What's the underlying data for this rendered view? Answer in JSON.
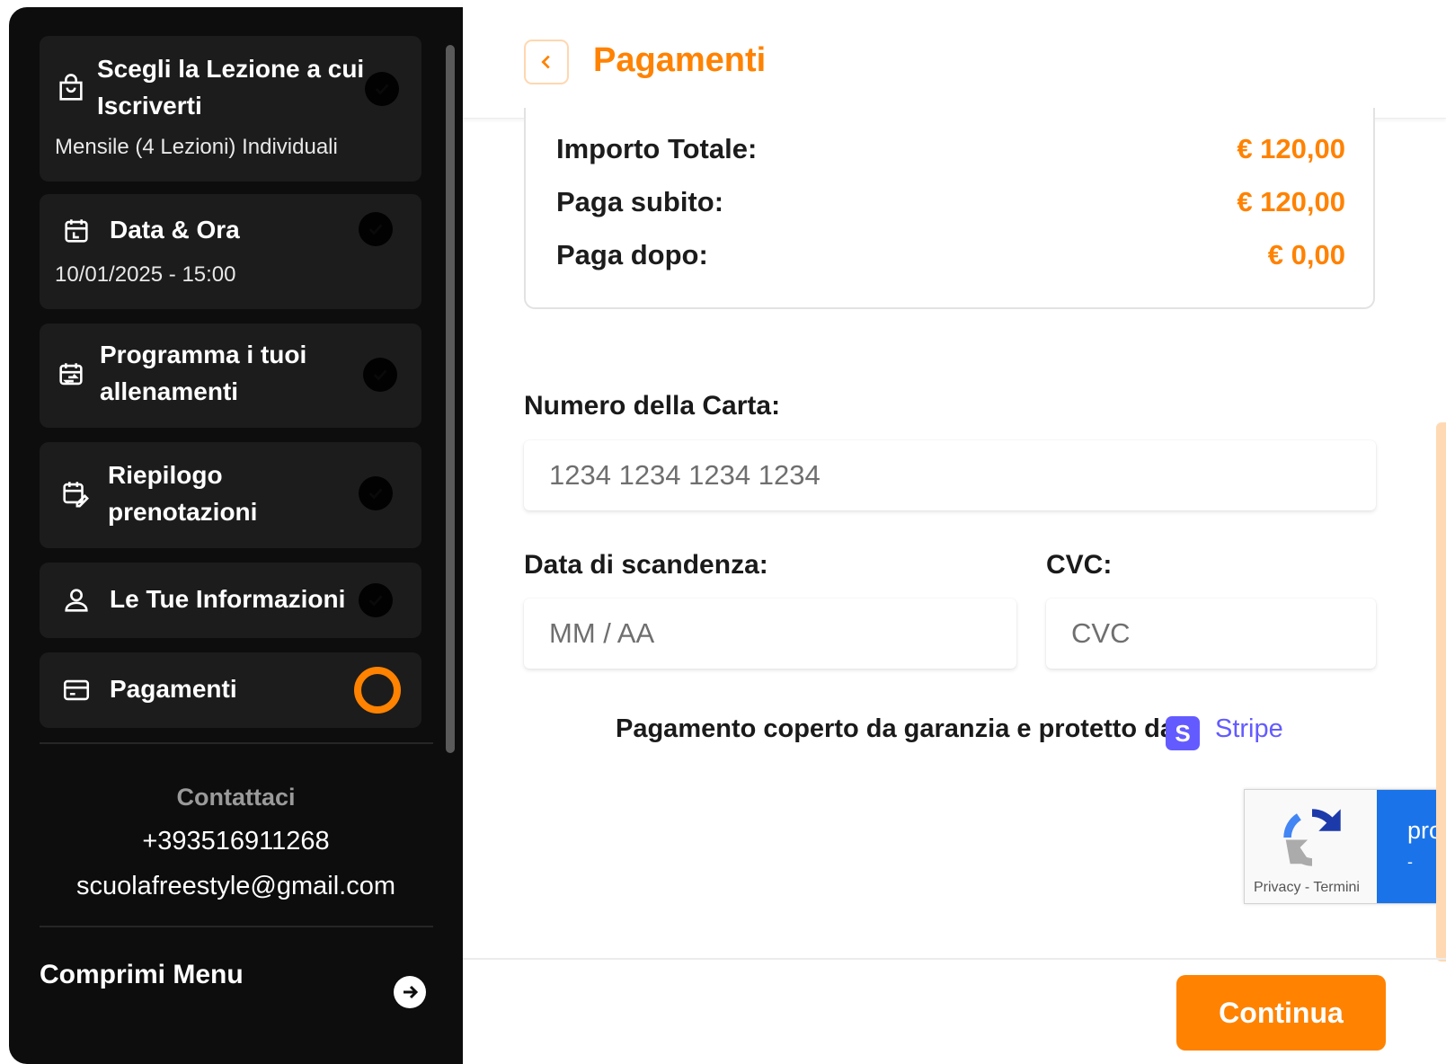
{
  "sidebar": {
    "steps": [
      {
        "title_line1": "Scegli la Lezione a cui",
        "title_line2": "Iscriverti",
        "subtitle": "Mensile (4 Lezioni) Individuali",
        "icon": "shopping-bag-icon",
        "status": "done"
      },
      {
        "title_line1": "Data & Ora",
        "subtitle": "10/01/2025 - 15:00",
        "icon": "calendar-icon",
        "status": "done"
      },
      {
        "title_line1": "Programma i tuoi",
        "title_line2": "allenamenti",
        "icon": "calendar-repeat-icon",
        "status": "done"
      },
      {
        "title_line1": "Riepilogo",
        "title_line2": "prenotazioni",
        "icon": "calendar-edit-icon",
        "status": "done"
      },
      {
        "title_line1": "Le Tue Informazioni",
        "icon": "user-icon",
        "status": "done"
      },
      {
        "title_line1": "Pagamenti",
        "icon": "credit-card-icon",
        "status": "current"
      }
    ],
    "contact": {
      "title": "Contattaci",
      "phone": "+393516911268",
      "email": "scuolafreestyle@gmail.com"
    },
    "collapse_label": "Comprimi Menu"
  },
  "header": {
    "title": "Pagamenti"
  },
  "summary": {
    "total_label": "Importo Totale:",
    "total_value": "€ 120,00",
    "pay_now_label": "Paga subito:",
    "pay_now_value": "€ 120,00",
    "pay_later_label": "Paga dopo:",
    "pay_later_value": "€ 0,00"
  },
  "payment_form": {
    "card_number_label": "Numero della Carta:",
    "card_number_placeholder": "1234 1234 1234 1234",
    "expiry_label": "Data di scandenza:",
    "expiry_placeholder": "MM / AA",
    "cvc_label": "CVC:",
    "cvc_placeholder": "CVC",
    "secure_text": "Pagamento coperto da garanzia e protetto da",
    "stripe_badge": "S",
    "stripe_name": "Stripe"
  },
  "recaptcha": {
    "links": "Privacy - Termini",
    "blue_text": "pro",
    "blue_sub": "-"
  },
  "footer": {
    "continue_label": "Continua"
  },
  "colors": {
    "accent": "#ff8200",
    "sidebar_bg": "#0d0d0d",
    "stripe": "#635bff"
  }
}
